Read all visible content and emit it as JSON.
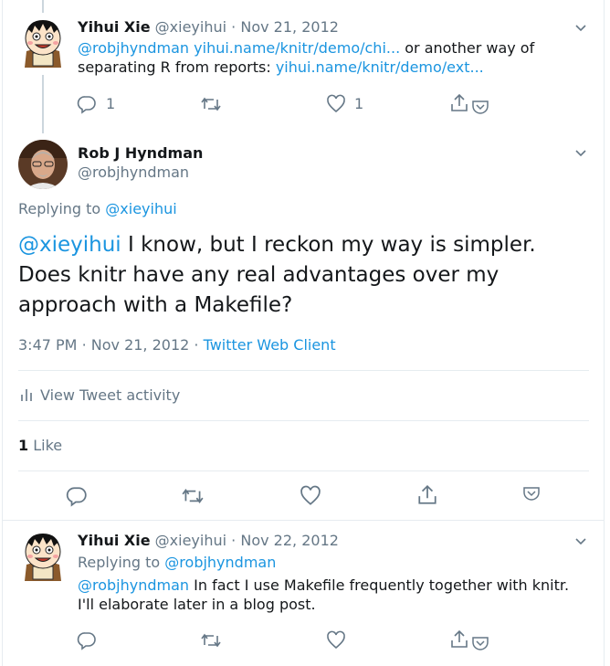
{
  "tweet1": {
    "name": "Yihui Xie",
    "handle": "@xieyihui",
    "date": "Nov 21, 2012",
    "mention": "@robjhyndman",
    "link1": "yihui.name/knitr/demo/chi...",
    "text_middle": " or another way of separating R from reports: ",
    "link2": "yihui.name/knitr/demo/ext...",
    "reply_count": "1",
    "like_count": "1"
  },
  "main": {
    "name": "Rob J Hyndman",
    "handle": "@robjhyndman",
    "replying_prefix": "Replying to ",
    "replying_handle": "@xieyihui",
    "mention": "@xieyihui",
    "text": " I know, but I reckon my way is simpler. Does knitr have any real advantages over my approach with a Makefile?",
    "time": "3:47 PM",
    "date": "Nov 21, 2012",
    "client": "Twitter Web Client",
    "activity_label": "View Tweet activity",
    "like_count": "1",
    "like_label": "Like"
  },
  "tweet3": {
    "name": "Yihui Xie",
    "handle": "@xieyihui",
    "date": "Nov 22, 2012",
    "replying_prefix": "Replying to ",
    "replying_handle": "@robjhyndman",
    "mention": "@robjhyndman",
    "text": " In fact I use Makefile frequently together with knitr. I'll elaborate later in a blog post."
  },
  "colors": {
    "accent": "#1b95e0",
    "muted": "#657786",
    "text": "#14171a"
  }
}
